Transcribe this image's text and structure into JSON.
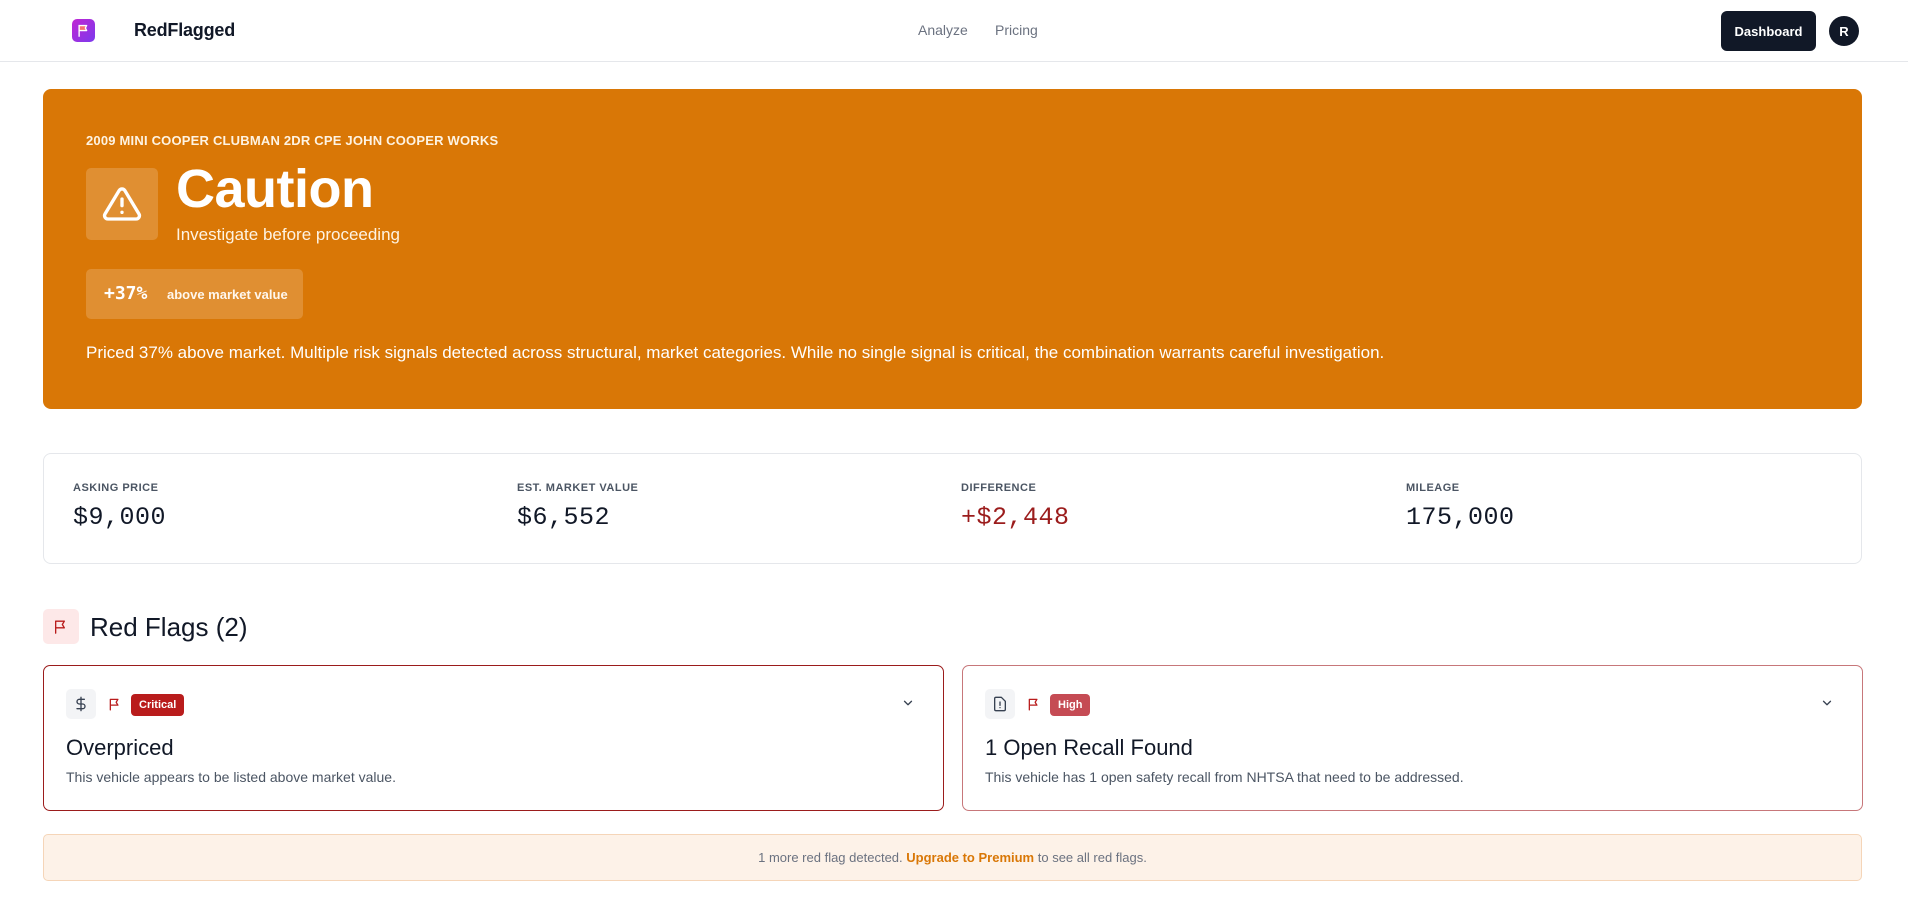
{
  "header": {
    "brand": "RedFlagged",
    "nav": {
      "analyze": "Analyze",
      "pricing": "Pricing"
    },
    "dashboard_label": "Dashboard",
    "avatar_initial": "R"
  },
  "hero": {
    "vehicle": "2009 MINI COOPER CLUBMAN 2DR CPE JOHN COOPER WORKS",
    "verdict": "Caution",
    "verdict_sub": "Investigate before proceeding",
    "percent": "+37%",
    "percent_label": "above market value",
    "summary": "Priced 37% above market. Multiple risk signals detected across structural, market categories. While no single signal is critical, the combination warrants careful investigation.",
    "color": "#d97706"
  },
  "stats": [
    {
      "label": "ASKING PRICE",
      "value": "$9,000"
    },
    {
      "label": "EST. MARKET VALUE",
      "value": "$6,552"
    },
    {
      "label": "DIFFERENCE",
      "value": "+$2,448"
    },
    {
      "label": "MILEAGE",
      "value": "175,000"
    }
  ],
  "red_flags": {
    "title": "Red Flags (2)",
    "items": [
      {
        "icon": "dollar-icon",
        "severity": "Critical",
        "title": "Overpriced",
        "description": "This vehicle appears to be listed above market value."
      },
      {
        "icon": "alert-file-icon",
        "severity": "High",
        "title": "1 Open Recall Found",
        "description": "This vehicle has 1 open safety recall from NHTSA that need to be addressed."
      }
    ]
  },
  "notice": {
    "prefix": "1 more red flag detected.",
    "link": "Upgrade to Premium",
    "suffix": "to see all red flags."
  }
}
